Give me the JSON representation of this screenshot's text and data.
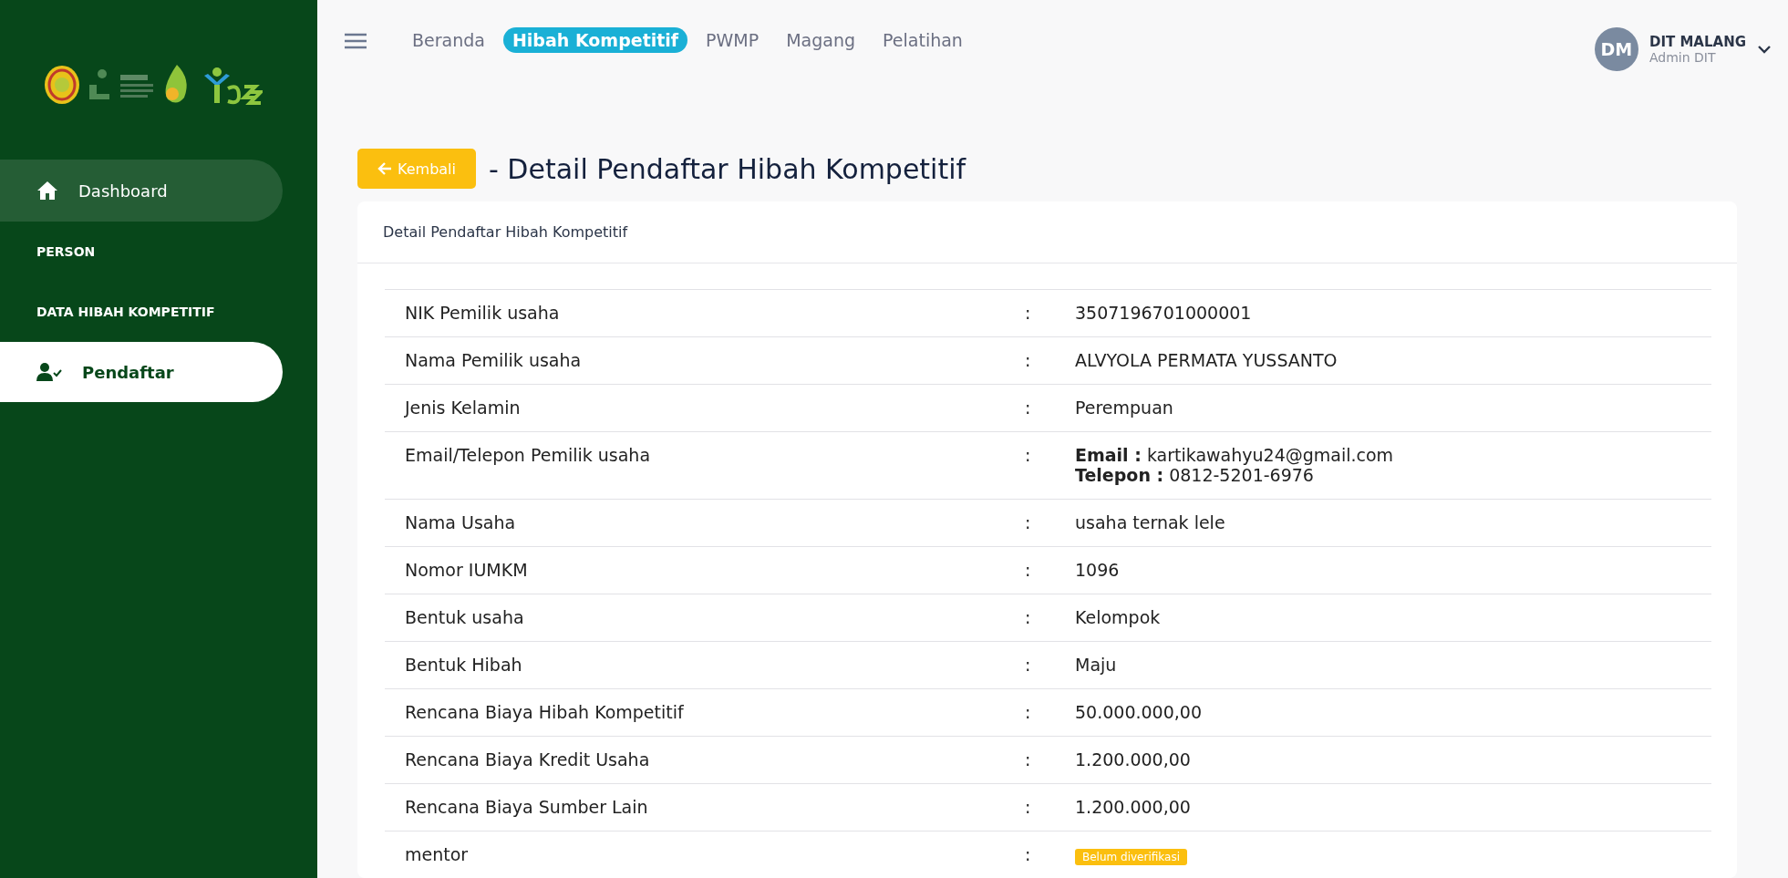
{
  "sidebar": {
    "items": [
      {
        "kind": "main",
        "label": "Dashboard",
        "selected": false
      },
      {
        "kind": "section",
        "label": "PERSON",
        "selected": false
      },
      {
        "kind": "section",
        "label": "DATA HIBAH KOMPETITIF",
        "selected": false
      },
      {
        "kind": "item",
        "label": "Pendaftar",
        "selected": true
      }
    ]
  },
  "topbar": {
    "nav": [
      {
        "label": "Beranda",
        "selected": false
      },
      {
        "label": "Hibah Kompetitif",
        "selected": true
      },
      {
        "label": "PWMP",
        "selected": false
      },
      {
        "label": "Magang",
        "selected": false
      },
      {
        "label": "Pelatihan",
        "selected": false
      }
    ],
    "user": {
      "initials": "DM",
      "name": "DIT MALANG",
      "role": "Admin DIT"
    }
  },
  "page": {
    "back_button": "Kembali",
    "title": "- Detail Pendaftar Hibah Kompetitif"
  },
  "card": {
    "header": "Detail Pendaftar Hibah Kompetitif",
    "rows": [
      {
        "kind": "text",
        "label": "NIK Pemilik usaha",
        "separator": ":",
        "value": "3507196701000001"
      },
      {
        "kind": "text",
        "label": "Nama Pemilik usaha",
        "separator": ":",
        "value": "ALVYOLA PERMATA YUSSANTO"
      },
      {
        "kind": "text",
        "label": "Jenis Kelamin",
        "separator": ":",
        "value": "Perempuan"
      },
      {
        "kind": "lines",
        "label": "Email/Telepon Pemilik usaha",
        "separator": ":",
        "lines": [
          "**Email :** kartikawahyu24@gmail.com",
          "**Telepon :** 0812-5201-6976"
        ]
      },
      {
        "kind": "text",
        "label": "Nama Usaha",
        "separator": ":",
        "value": "usaha ternak lele"
      },
      {
        "kind": "text",
        "label": "Nomor IUMKM",
        "separator": ":",
        "value": "1096"
      },
      {
        "kind": "text",
        "label": "Bentuk usaha",
        "separator": ":",
        "value": "Kelompok"
      },
      {
        "kind": "text",
        "label": "Bentuk Hibah",
        "separator": ":",
        "value": "Maju"
      },
      {
        "kind": "text",
        "label": "Rencana Biaya Hibah Kompetitif",
        "separator": ":",
        "value": "50.000.000,00"
      },
      {
        "kind": "text",
        "label": "Rencana Biaya Kredit Usaha",
        "separator": ":",
        "value": "1.200.000,00"
      },
      {
        "kind": "text",
        "label": "Rencana Biaya Sumber Lain",
        "separator": ":",
        "value": "1.200.000,00"
      },
      {
        "kind": "badge",
        "label": "mentor",
        "separator": ":",
        "value": "Belum diverifikasi"
      }
    ]
  }
}
